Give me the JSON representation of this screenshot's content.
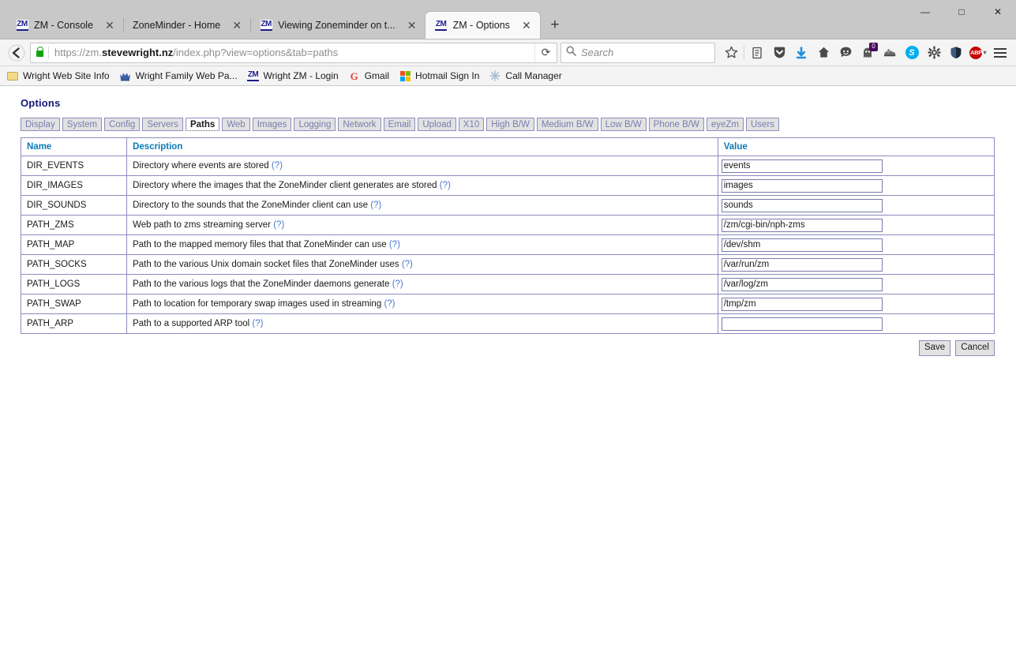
{
  "browser": {
    "tabs": [
      {
        "title": "ZM - Console",
        "favicon": "zoneminder-icon",
        "active": false,
        "close_label": "✕"
      },
      {
        "title": "ZoneMinder - Home",
        "favicon": "none",
        "active": false,
        "close_label": "✕"
      },
      {
        "title": "Viewing Zoneminder on t...",
        "favicon": "zoneminder-icon",
        "active": false,
        "close_label": "✕"
      },
      {
        "title": "ZM - Options",
        "favicon": "zoneminder-icon",
        "active": true,
        "close_label": "✕"
      }
    ],
    "new_tab_label": "+",
    "window_controls": {
      "minimize": "—",
      "maximize": "□",
      "close": "✕"
    },
    "back_label": "←",
    "url": {
      "scheme": "https://zm.",
      "domain": "stevewright.nz",
      "path": "/index.php?view=options&tab=paths",
      "full": "https://zm.stevewright.nz/index.php?view=options&tab=paths",
      "security": "secure-lock-icon"
    },
    "reload_label": "⟳",
    "search": {
      "placeholder": "Search",
      "icon": "search-icon"
    },
    "toolbar_icons": [
      {
        "name": "bookmark-star-icon",
        "glyph": "☆"
      },
      {
        "name": "reading-list-icon",
        "glyph": "☰"
      },
      {
        "name": "pocket-icon",
        "glyph": "▼"
      },
      {
        "name": "downloads-icon",
        "glyph": "⬇"
      },
      {
        "name": "home-icon",
        "glyph": "⌂"
      },
      {
        "name": "chat-icon",
        "glyph": "☺"
      },
      {
        "name": "ghostery-icon",
        "glyph": "●",
        "badge": "0"
      },
      {
        "name": "shoe-icon",
        "glyph": "◆"
      },
      {
        "name": "skype-icon",
        "glyph": "S"
      },
      {
        "name": "settings-gear-icon",
        "glyph": "⚙"
      },
      {
        "name": "ublock-icon",
        "glyph": "◗"
      },
      {
        "name": "adblock-plus-icon",
        "glyph": "ABP"
      }
    ],
    "menu_label": "menu-icon",
    "bookmarks": [
      {
        "label": "Wright Web Site Info",
        "icon": "folder-icon"
      },
      {
        "label": "Wright Family Web Pa...",
        "icon": "crown-icon"
      },
      {
        "label": "Wright ZM - Login",
        "icon": "zoneminder-icon"
      },
      {
        "label": "Gmail",
        "icon": "google-icon"
      },
      {
        "label": "Hotmail Sign In",
        "icon": "microsoft-icon"
      },
      {
        "label": "Call Manager",
        "icon": "sparkle-icon"
      }
    ]
  },
  "page": {
    "title": "Options",
    "tabs": [
      {
        "label": "Display",
        "active": false
      },
      {
        "label": "System",
        "active": false
      },
      {
        "label": "Config",
        "active": false
      },
      {
        "label": "Servers",
        "active": false
      },
      {
        "label": "Paths",
        "active": true
      },
      {
        "label": "Web",
        "active": false
      },
      {
        "label": "Images",
        "active": false
      },
      {
        "label": "Logging",
        "active": false
      },
      {
        "label": "Network",
        "active": false
      },
      {
        "label": "Email",
        "active": false
      },
      {
        "label": "Upload",
        "active": false
      },
      {
        "label": "X10",
        "active": false
      },
      {
        "label": "High B/W",
        "active": false
      },
      {
        "label": "Medium B/W",
        "active": false
      },
      {
        "label": "Low B/W",
        "active": false
      },
      {
        "label": "Phone B/W",
        "active": false
      },
      {
        "label": "eyeZm",
        "active": false
      },
      {
        "label": "Users",
        "active": false
      }
    ],
    "table": {
      "headers": {
        "name": "Name",
        "description": "Description",
        "value": "Value"
      },
      "help_marker": "(?)",
      "rows": [
        {
          "name": "DIR_EVENTS",
          "description": "Directory where events are stored",
          "value": "events"
        },
        {
          "name": "DIR_IMAGES",
          "description": "Directory where the images that the ZoneMinder client generates are stored",
          "value": "images"
        },
        {
          "name": "DIR_SOUNDS",
          "description": "Directory to the sounds that the ZoneMinder client can use",
          "value": "sounds"
        },
        {
          "name": "PATH_ZMS",
          "description": "Web path to zms streaming server",
          "value": "/zm/cgi-bin/nph-zms"
        },
        {
          "name": "PATH_MAP",
          "description": "Path to the mapped memory files that that ZoneMinder can use",
          "value": "/dev/shm"
        },
        {
          "name": "PATH_SOCKS",
          "description": "Path to the various Unix domain socket files that ZoneMinder uses",
          "value": "/var/run/zm"
        },
        {
          "name": "PATH_LOGS",
          "description": "Path to the various logs that the ZoneMinder daemons generate",
          "value": "/var/log/zm"
        },
        {
          "name": "PATH_SWAP",
          "description": "Path to location for temporary swap images used in streaming",
          "value": "/tmp/zm"
        },
        {
          "name": "PATH_ARP",
          "description": "Path to a supported ARP tool",
          "value": ""
        }
      ]
    },
    "buttons": {
      "save": "Save",
      "cancel": "Cancel"
    }
  },
  "colors": {
    "page_title": "#16167a",
    "table_header": "#0b7bb5",
    "table_border": "#8c8cbf",
    "tab_inactive_text": "#7b7bb0",
    "help_link": "#4a78d6",
    "badge": "#4c0a5c",
    "lock_green": "#12a312"
  }
}
